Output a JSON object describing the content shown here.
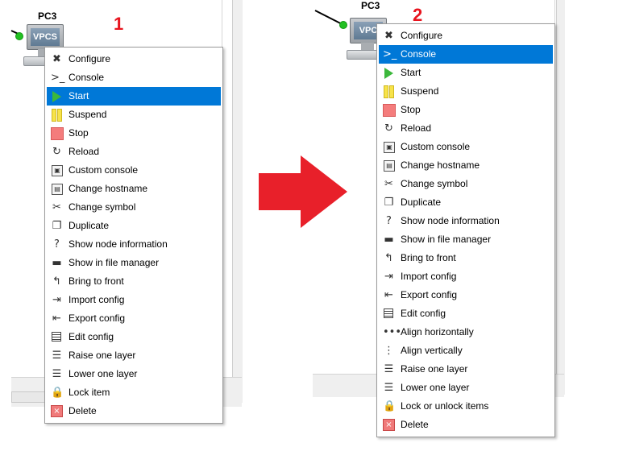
{
  "left": {
    "node_label": "PC3",
    "node_icon_text": "VPCS",
    "step": "1",
    "menu_items": [
      {
        "label": "Configure",
        "icon": "wrench-icon",
        "glyph": "✖"
      },
      {
        "label": "Console",
        "icon": "console-icon",
        "glyph": ">_"
      },
      {
        "label": "Start",
        "icon": "start-icon",
        "glyph": ""
      },
      {
        "label": "Suspend",
        "icon": "suspend-icon",
        "glyph": ""
      },
      {
        "label": "Stop",
        "icon": "stop-icon",
        "glyph": ""
      },
      {
        "label": "Reload",
        "icon": "reload-icon",
        "glyph": "↻"
      },
      {
        "label": "Custom console",
        "icon": "custom-console-icon",
        "glyph": "▣"
      },
      {
        "label": "Change hostname",
        "icon": "hostname-icon",
        "glyph": "▤"
      },
      {
        "label": "Change symbol",
        "icon": "symbol-icon",
        "glyph": "✂"
      },
      {
        "label": "Duplicate",
        "icon": "duplicate-icon",
        "glyph": "❐"
      },
      {
        "label": "Show node information",
        "icon": "info-icon",
        "glyph": "?"
      },
      {
        "label": "Show in file manager",
        "icon": "folder-icon",
        "glyph": "▬"
      },
      {
        "label": "Bring to front",
        "icon": "bring-front-icon",
        "glyph": "↰"
      },
      {
        "label": "Import config",
        "icon": "import-icon",
        "glyph": "⇥"
      },
      {
        "label": "Export config",
        "icon": "export-icon",
        "glyph": "⇤"
      },
      {
        "label": "Edit config",
        "icon": "edit-config-icon",
        "glyph": ""
      },
      {
        "label": "Raise one layer",
        "icon": "raise-layer-icon",
        "glyph": "☰"
      },
      {
        "label": "Lower one layer",
        "icon": "lower-layer-icon",
        "glyph": "☰"
      },
      {
        "label": "Lock item",
        "icon": "lock-icon",
        "glyph": "🔒"
      },
      {
        "label": "Delete",
        "icon": "delete-icon",
        "glyph": "×"
      }
    ],
    "highlighted": "Start"
  },
  "right": {
    "node_label": "PC3",
    "node_icon_text": "VPC",
    "step": "2",
    "menu_items": [
      {
        "label": "Configure",
        "icon": "wrench-icon",
        "glyph": "✖"
      },
      {
        "label": "Console",
        "icon": "console-icon",
        "glyph": ">_"
      },
      {
        "label": "Start",
        "icon": "start-icon",
        "glyph": ""
      },
      {
        "label": "Suspend",
        "icon": "suspend-icon",
        "glyph": ""
      },
      {
        "label": "Stop",
        "icon": "stop-icon",
        "glyph": ""
      },
      {
        "label": "Reload",
        "icon": "reload-icon",
        "glyph": "↻"
      },
      {
        "label": "Custom console",
        "icon": "custom-console-icon",
        "glyph": "▣"
      },
      {
        "label": "Change hostname",
        "icon": "hostname-icon",
        "glyph": "▤"
      },
      {
        "label": "Change symbol",
        "icon": "symbol-icon",
        "glyph": "✂"
      },
      {
        "label": "Duplicate",
        "icon": "duplicate-icon",
        "glyph": "❐"
      },
      {
        "label": "Show node information",
        "icon": "info-icon",
        "glyph": "?"
      },
      {
        "label": "Show in file manager",
        "icon": "folder-icon",
        "glyph": "▬"
      },
      {
        "label": "Bring to front",
        "icon": "bring-front-icon",
        "glyph": "↰"
      },
      {
        "label": "Import config",
        "icon": "import-icon",
        "glyph": "⇥"
      },
      {
        "label": "Export config",
        "icon": "export-icon",
        "glyph": "⇤"
      },
      {
        "label": "Edit config",
        "icon": "edit-config-icon",
        "glyph": ""
      },
      {
        "label": "Align horizontally",
        "icon": "align-horizontal-icon",
        "glyph": "•••"
      },
      {
        "label": "Align vertically",
        "icon": "align-vertical-icon",
        "glyph": "⋮"
      },
      {
        "label": "Raise one layer",
        "icon": "raise-layer-icon",
        "glyph": "☰"
      },
      {
        "label": "Lower one layer",
        "icon": "lower-layer-icon",
        "glyph": "☰"
      },
      {
        "label": "Lock or unlock items",
        "icon": "lock-icon",
        "glyph": "🔒"
      },
      {
        "label": "Delete",
        "icon": "delete-icon",
        "glyph": "×"
      }
    ],
    "highlighted": "Console"
  },
  "colors": {
    "highlight": "#0078d7",
    "step_number": "#e8141e",
    "arrow": "#e8202a",
    "link_dot": "#22c022"
  }
}
